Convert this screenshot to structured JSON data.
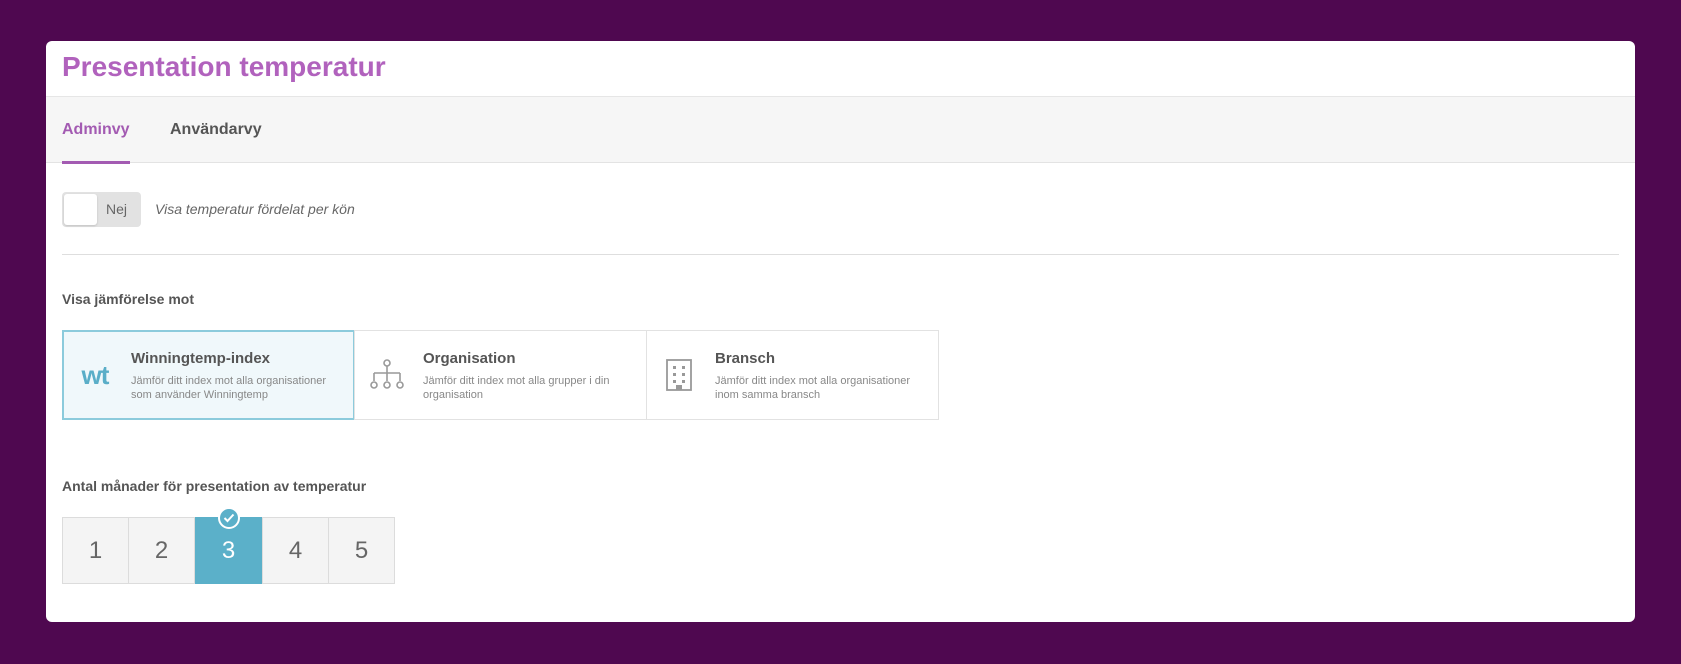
{
  "page": {
    "title": "Presentation temperatur"
  },
  "tabs": [
    {
      "label": "Adminvy",
      "active": true
    },
    {
      "label": "Användarvy",
      "active": false
    }
  ],
  "gender_toggle": {
    "value_label": "Nej",
    "checked": false,
    "description": "Visa temperatur fördelat per kön"
  },
  "comparison": {
    "label": "Visa jämförelse mot",
    "options": [
      {
        "icon": "wt",
        "icon_name": "winningtemp-logo-icon",
        "title": "Winningtemp-index",
        "description": "Jämför ditt index mot alla organisationer som använder Winningtemp",
        "selected": true
      },
      {
        "icon_name": "org-chart-icon",
        "title": "Organisation",
        "description": "Jämför ditt index mot alla grupper i din organisation",
        "selected": false
      },
      {
        "icon_name": "building-icon",
        "title": "Bransch",
        "description": "Jämför ditt index mot alla organisationer inom samma bransch",
        "selected": false
      }
    ]
  },
  "months": {
    "label": "Antal månader för presentation av temperatur",
    "options": [
      "1",
      "2",
      "3",
      "4",
      "5"
    ],
    "selected": "3"
  },
  "colors": {
    "background": "#4f0850",
    "title": "#b162bd",
    "tab_active": "#a35bb2",
    "selected_accent": "#5bb0c9"
  }
}
